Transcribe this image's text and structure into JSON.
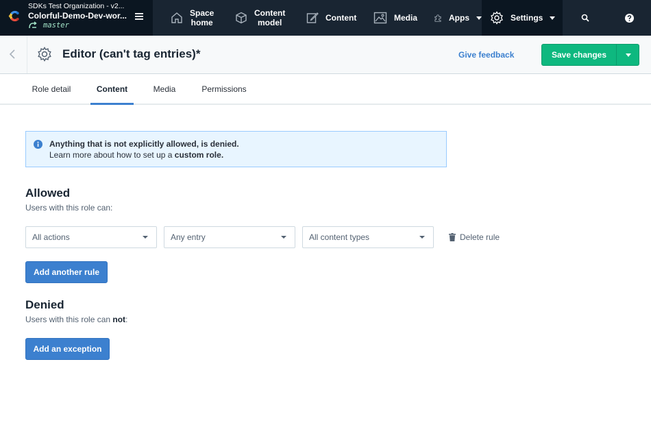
{
  "topnav": {
    "org_name": "SDKs Test Organization - v2...",
    "space_name": "Colorful-Demo-Dev-wor...",
    "environment": "master",
    "items": [
      {
        "line1": "Space",
        "line2": "home"
      },
      {
        "line1": "Content",
        "line2": "model"
      },
      {
        "label": "Content"
      },
      {
        "label": "Media"
      },
      {
        "label": "Apps"
      },
      {
        "label": "Settings"
      }
    ]
  },
  "header": {
    "title": "Editor (can't tag entries)*",
    "feedback_label": "Give feedback",
    "save_label": "Save changes"
  },
  "tabs": [
    {
      "label": "Role detail",
      "active": false
    },
    {
      "label": "Content",
      "active": true
    },
    {
      "label": "Media",
      "active": false
    },
    {
      "label": "Permissions",
      "active": false
    }
  ],
  "note": {
    "title": "Anything that is not explicitly allowed, is denied.",
    "text_prefix": "Learn more about how to set up a",
    "link": "custom role."
  },
  "allowed": {
    "title": "Allowed",
    "subtitle": "Users with this role can:",
    "rule": {
      "action": "All actions",
      "entry": "Any entry",
      "content_type": "All content types",
      "delete_label": "Delete rule"
    },
    "add_label": "Add another rule"
  },
  "denied": {
    "title": "Denied",
    "subtitle_prefix": "Users with this role can",
    "subtitle_bold": "not",
    "subtitle_suffix": ":",
    "add_label": "Add an exception"
  },
  "colors": {
    "nav_bg": "#192532",
    "primary": "#3c80cf",
    "positive": "#0eb87f",
    "note_bg": "#e8f5ff"
  }
}
